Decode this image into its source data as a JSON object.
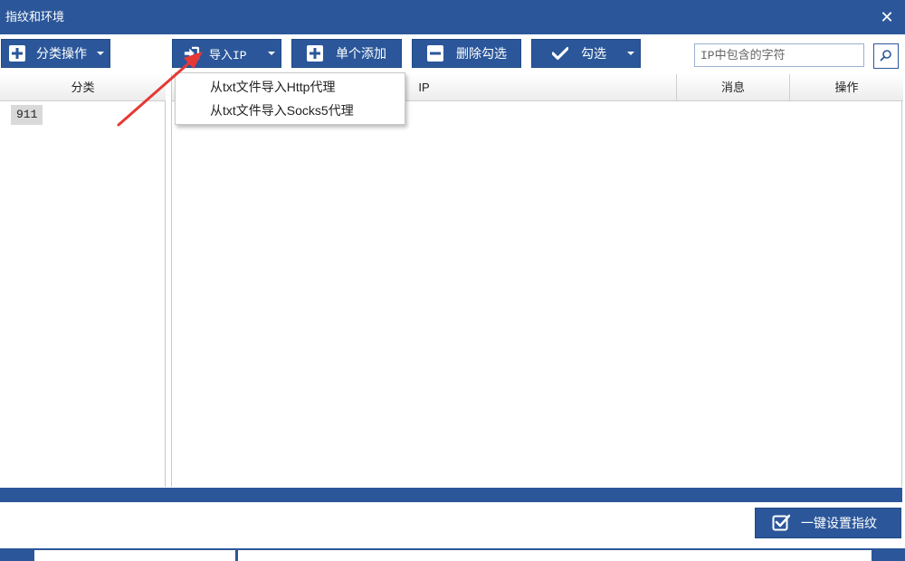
{
  "window": {
    "title": "指纹和环境",
    "close_symbol": "✕"
  },
  "toolbar": {
    "category_ops": {
      "label": "分类操作"
    },
    "import_ip": {
      "label": "导入IP"
    },
    "single_add": {
      "label": "单个添加"
    },
    "delete_checked": {
      "label": "删除勾选"
    },
    "check": {
      "label": "勾选"
    }
  },
  "search": {
    "placeholder": "IP中包含的字符"
  },
  "import_menu": {
    "items": [
      {
        "label": "从txt文件导入Http代理"
      },
      {
        "label": "从txt文件导入Socks5代理"
      }
    ]
  },
  "category_panel": {
    "header": "分类",
    "items": [
      {
        "label": "911"
      }
    ]
  },
  "ip_table": {
    "columns": [
      {
        "label": "IP"
      },
      {
        "label": "消息"
      },
      {
        "label": "操作"
      }
    ],
    "rows": []
  },
  "progress": {
    "value": 1.0
  },
  "footer": {
    "set_fingerprint": {
      "label": "一键设置指纹"
    }
  },
  "colors": {
    "primary": "#2b579a",
    "annotation_arrow": "#e53935"
  },
  "icons": {
    "category_ops": "plus-box-icon",
    "import_ip": "sign-in-icon",
    "single_add": "plus-box-icon",
    "delete_checked": "minus-box-icon",
    "check": "checkmark-icon",
    "search": "search-icon",
    "set_fingerprint": "checkbox-checked-icon"
  }
}
